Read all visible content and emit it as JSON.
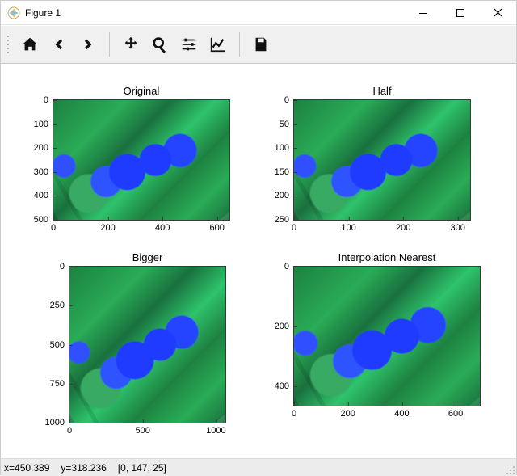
{
  "window": {
    "title": "Figure 1"
  },
  "toolbar": {
    "home": "Home",
    "back": "Back",
    "forward": "Forward",
    "pan": "Pan",
    "zoom": "Zoom",
    "configure": "Configure subplots",
    "edit": "Edit axes",
    "save": "Save"
  },
  "status": {
    "x_label": "x=",
    "x_val": "450.389",
    "y_label": "y=",
    "y_val": "318.236",
    "rgb": "[0, 147, 25]"
  },
  "subplots": [
    {
      "title": "Original",
      "yticks": [
        "0",
        "100",
        "200",
        "300",
        "400",
        "500"
      ],
      "xticks": [
        "0",
        "200",
        "400",
        "600"
      ]
    },
    {
      "title": "Half",
      "yticks": [
        "0",
        "50",
        "100",
        "150",
        "200",
        "250"
      ],
      "xticks": [
        "0",
        "100",
        "200",
        "300"
      ]
    },
    {
      "title": "Bigger",
      "yticks": [
        "0",
        "250",
        "500",
        "750",
        "1000"
      ],
      "xticks": [
        "0",
        "500",
        "1000"
      ]
    },
    {
      "title": "Interpolation Nearest",
      "yticks": [
        "0",
        "200",
        "400"
      ],
      "xticks": [
        "0",
        "200",
        "400",
        "600"
      ]
    }
  ]
}
